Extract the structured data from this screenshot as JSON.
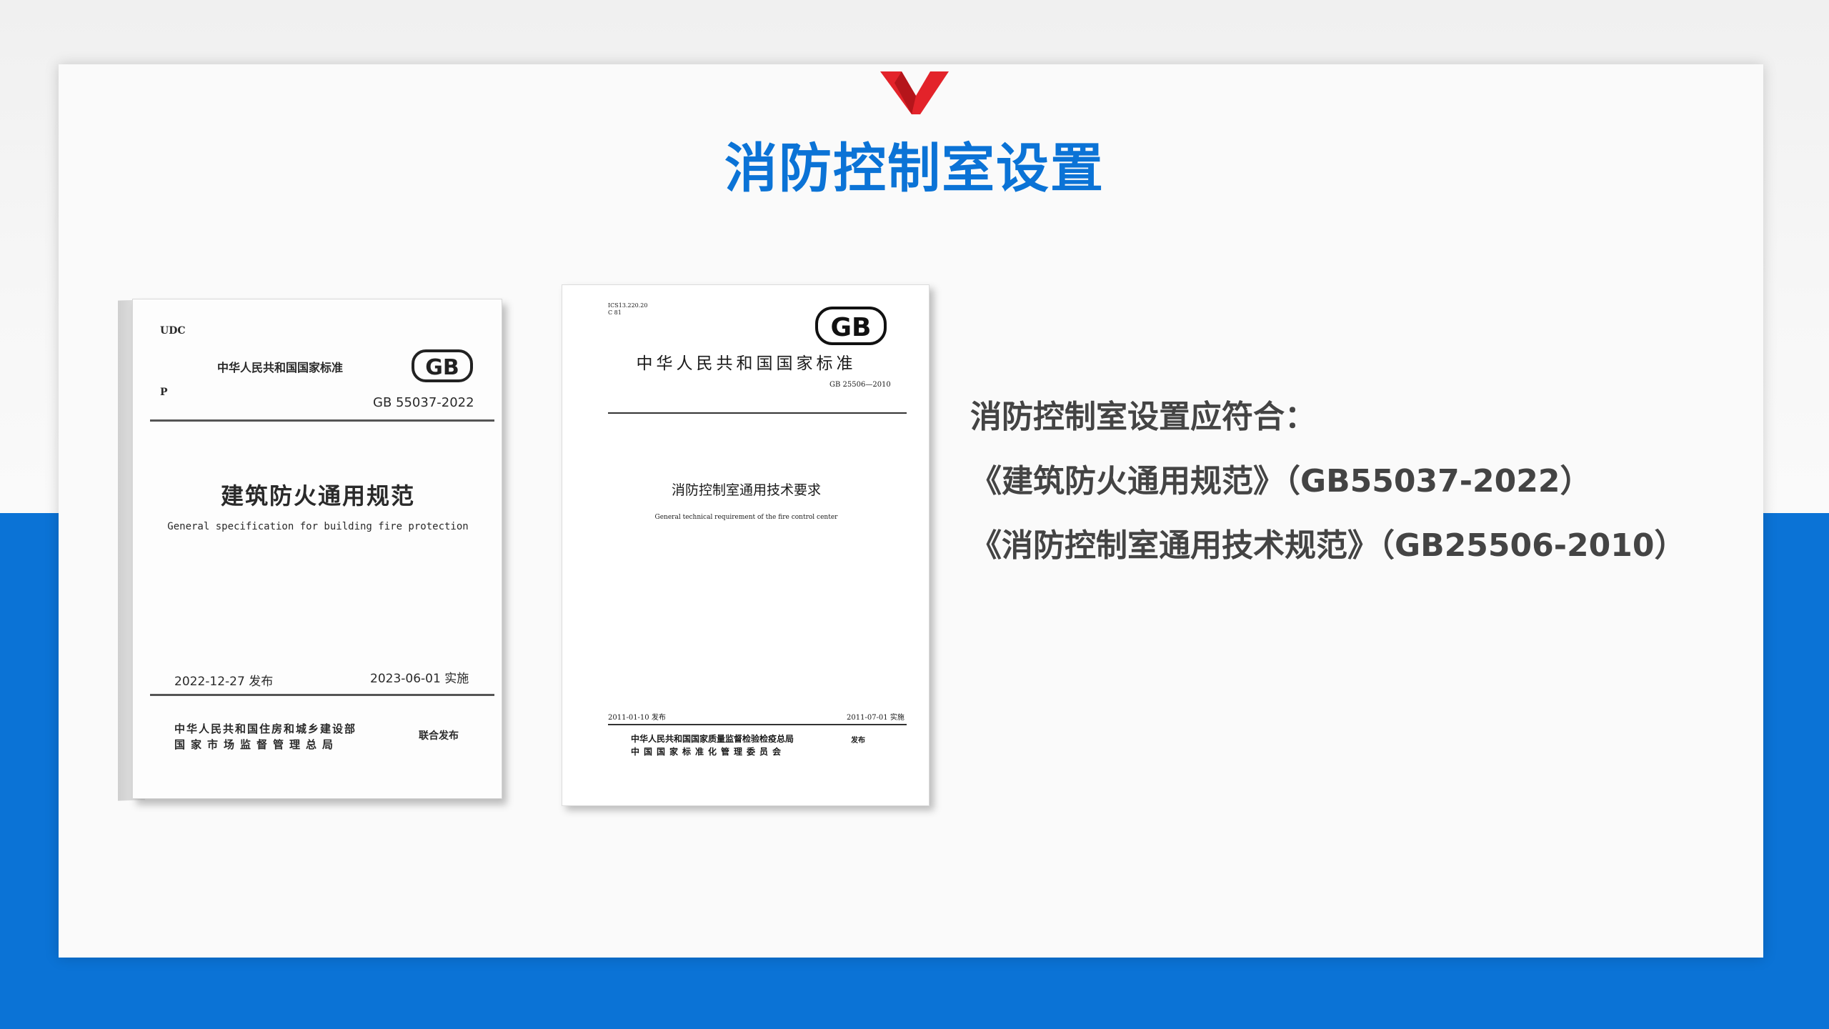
{
  "slide": {
    "title": "消防控制室设置",
    "brand_color": "#0b73d6",
    "logo_icon": "red-check-icon"
  },
  "intro": {
    "heading": "消防控制室设置应符合：",
    "items": [
      "《建筑防火通用规范》（GB55037-2022）",
      "《消防控制室通用技术规范》（GB25506-2010）"
    ]
  },
  "book1": {
    "udc": "UDC",
    "category": "P",
    "standard_type": "中华人民共和国国家标准",
    "gb_logo": "GB",
    "code": "GB 55037-2022",
    "title": "建筑防火通用规范",
    "subtitle": "General specification for building fire protection",
    "published": "2022-12-27  发布",
    "implemented": "2023-06-01  实施",
    "issuer_1": "中华人民共和国住房和城乡建设部",
    "issuer_2": "国家市场监督管理总局",
    "joint": "联合发布"
  },
  "book2": {
    "ics": "ICS13.220.20",
    "ccs": "C 81",
    "gb_logo": "GB",
    "standard_type": "中华人民共和国国家标准",
    "code": "GB 25506—2010",
    "title": "消防控制室通用技术要求",
    "subtitle": "General technical requirement of the fire control center",
    "published": "2011-01-10 发布",
    "implemented": "2011-07-01 实施",
    "issuer_1": "中华人民共和国国家质量监督检验检疫总局",
    "issuer_2": "中国国家标准化管理委员会",
    "joint": "发布"
  }
}
